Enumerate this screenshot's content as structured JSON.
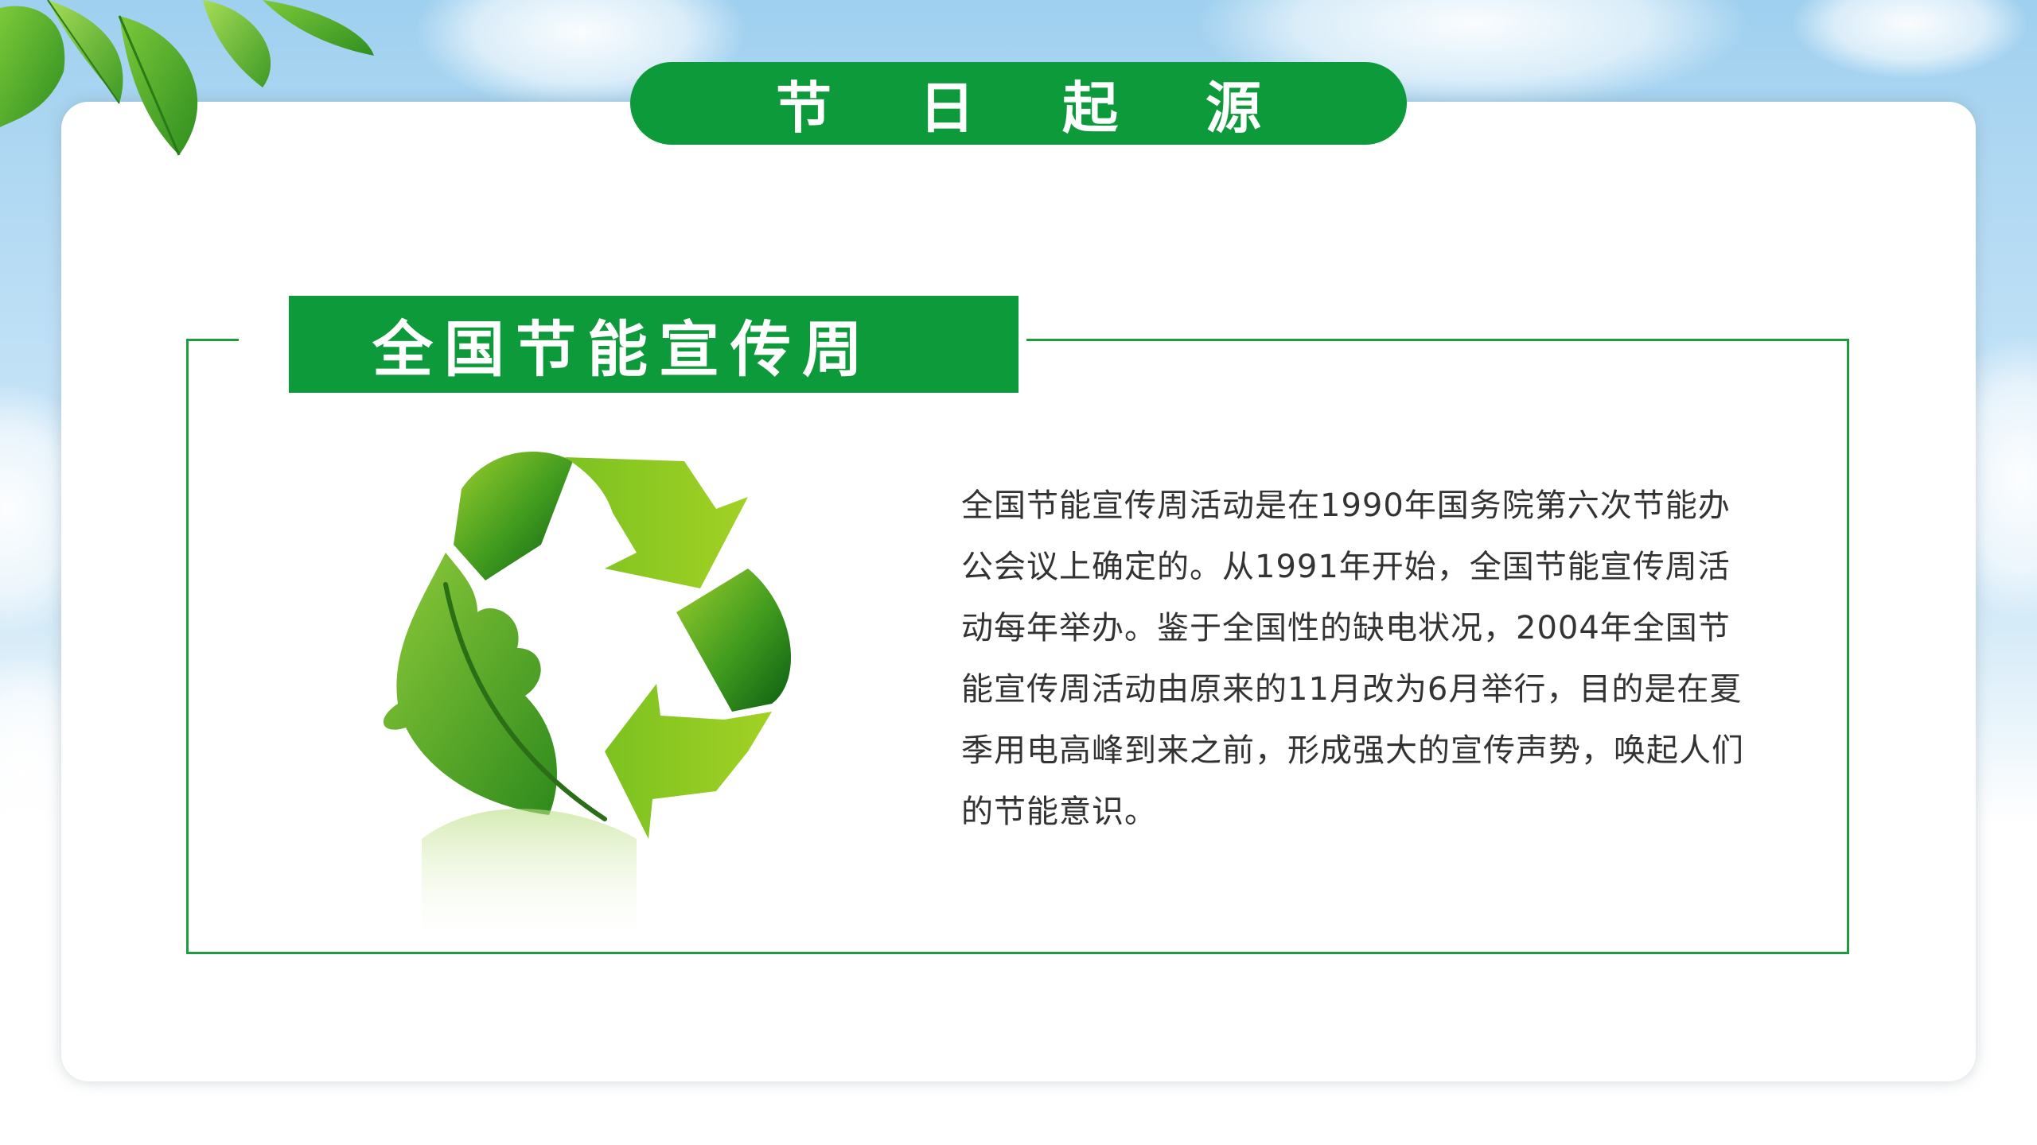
{
  "slide": {
    "title": "节日起源",
    "section_label": "全国节能宣传周",
    "body_text": "全国节能宣传周活动是在1990年国务院第六次节能办公会议上确定的。从1991年开始，全国节能宣传周活动每年举办。鉴于全国性的缺电状况，2004年全国节能宣传周活动由原来的11月改为6月举行，目的是在夏季用电高峰到来之前，形成强大的宣传声势，唤起人们的节能意识。"
  },
  "icons": {
    "corner_decoration": "green-leaves-icon",
    "illustration": "recycle-leaf-icon"
  },
  "colors": {
    "primary_green": "#0d9a3a",
    "frame_green": "#1e9a3f",
    "sky_blue": "#9fd0ef",
    "text": "#333333"
  }
}
